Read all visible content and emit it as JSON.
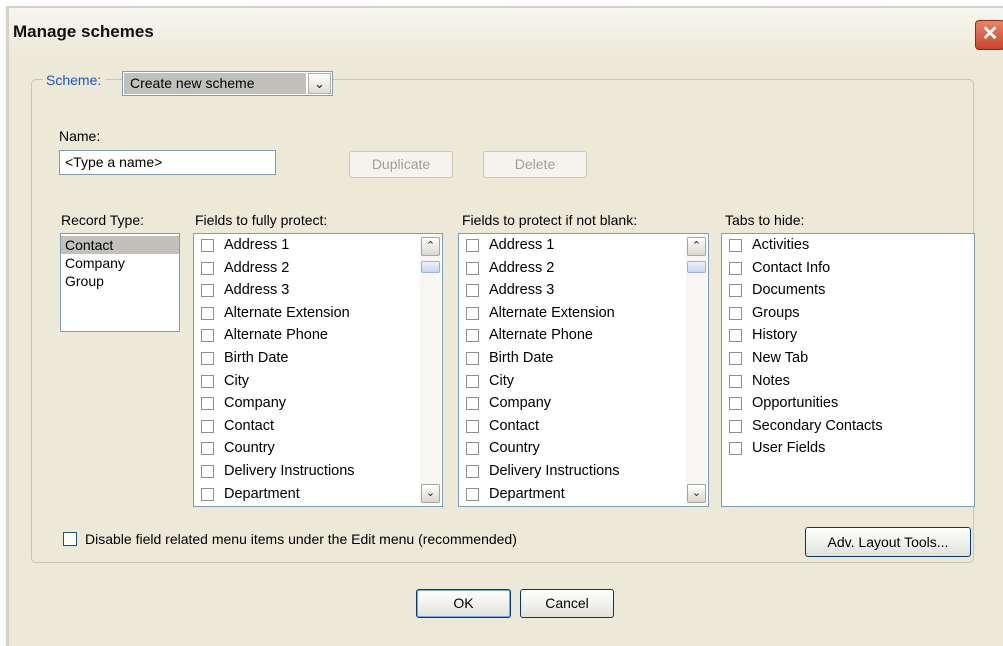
{
  "window": {
    "title": "Manage schemes",
    "close_glyph": "✕"
  },
  "scheme": {
    "label": "Scheme:",
    "value": "Create new scheme",
    "arrow_glyph": "⌄"
  },
  "name": {
    "label": "Name:",
    "value": "<Type a name>"
  },
  "buttons": {
    "duplicate": "Duplicate",
    "delete": "Delete",
    "adv_layout": "Adv. Layout Tools...",
    "ok": "OK",
    "cancel": "Cancel"
  },
  "record_type": {
    "label": "Record Type:",
    "items": [
      "Contact",
      "Company",
      "Group"
    ],
    "selected": "Contact"
  },
  "fields_fully": {
    "label": "Fields to fully protect:",
    "items": [
      "Address 1",
      "Address 2",
      "Address 3",
      "Alternate Extension",
      "Alternate Phone",
      "Birth Date",
      "City",
      "Company",
      "Contact",
      "Country",
      "Delivery Instructions",
      "Department"
    ]
  },
  "fields_if_not_blank": {
    "label": "Fields to protect if not blank:",
    "items": [
      "Address 1",
      "Address 2",
      "Address 3",
      "Alternate Extension",
      "Alternate Phone",
      "Birth Date",
      "City",
      "Company",
      "Contact",
      "Country",
      "Delivery Instructions",
      "Department"
    ]
  },
  "tabs_to_hide": {
    "label": "Tabs to hide:",
    "items": [
      "Activities",
      "Contact Info",
      "Documents",
      "Groups",
      "History",
      "New Tab",
      "Notes",
      "Opportunities",
      "Secondary Contacts",
      "User Fields"
    ]
  },
  "disable_option": {
    "label": "Disable field related menu items under the Edit menu (recommended)",
    "checked": false
  },
  "scroll_glyphs": {
    "up": "⌃",
    "down": "⌄"
  },
  "colors": {
    "scheme_label": "#1b55c9",
    "selection": "#c2c0bb",
    "dialog_bg": "#ece9d8"
  }
}
